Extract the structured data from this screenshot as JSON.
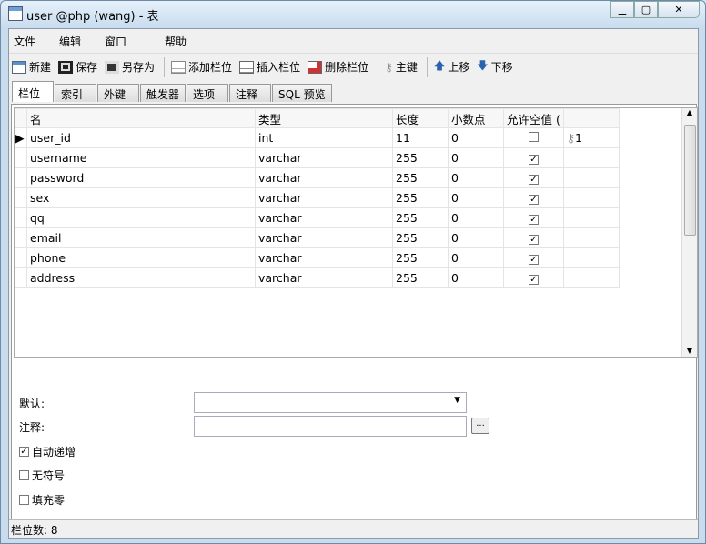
{
  "window": {
    "title": "user @php (wang) - 表"
  },
  "menu": [
    "文件",
    "编辑",
    "窗口",
    "帮助"
  ],
  "toolbar": {
    "new": "新建",
    "save": "保存",
    "save_as": "另存为",
    "add_field": "添加栏位",
    "insert_field": "插入栏位",
    "delete_field": "删除栏位",
    "primary_key": "主键",
    "move_up": "上移",
    "move_down": "下移"
  },
  "tabs": [
    "栏位",
    "索引",
    "外键",
    "触发器",
    "选项",
    "注释",
    "SQL 预览"
  ],
  "columns": [
    "名",
    "类型",
    "长度",
    "小数点",
    "允许空值 (",
    ""
  ],
  "rows": [
    {
      "name": "user_id",
      "type": "int",
      "length": "11",
      "decimals": "0",
      "nullable": false,
      "key": "1"
    },
    {
      "name": "username",
      "type": "varchar",
      "length": "255",
      "decimals": "0",
      "nullable": true,
      "key": ""
    },
    {
      "name": "password",
      "type": "varchar",
      "length": "255",
      "decimals": "0",
      "nullable": true,
      "key": ""
    },
    {
      "name": "sex",
      "type": "varchar",
      "length": "255",
      "decimals": "0",
      "nullable": true,
      "key": ""
    },
    {
      "name": "qq",
      "type": "varchar",
      "length": "255",
      "decimals": "0",
      "nullable": true,
      "key": ""
    },
    {
      "name": "email",
      "type": "varchar",
      "length": "255",
      "decimals": "0",
      "nullable": true,
      "key": ""
    },
    {
      "name": "phone",
      "type": "varchar",
      "length": "255",
      "decimals": "0",
      "nullable": true,
      "key": ""
    },
    {
      "name": "address",
      "type": "varchar",
      "length": "255",
      "decimals": "0",
      "nullable": true,
      "key": ""
    }
  ],
  "props": {
    "default_label": "默认:",
    "comment_label": "注释:",
    "ellipsis": "...",
    "auto_increment": "自动递增",
    "auto_increment_checked": true,
    "unsigned": "无符号",
    "unsigned_checked": false,
    "zerofill": "填充零",
    "zerofill_checked": false
  },
  "status": "栏位数: 8"
}
